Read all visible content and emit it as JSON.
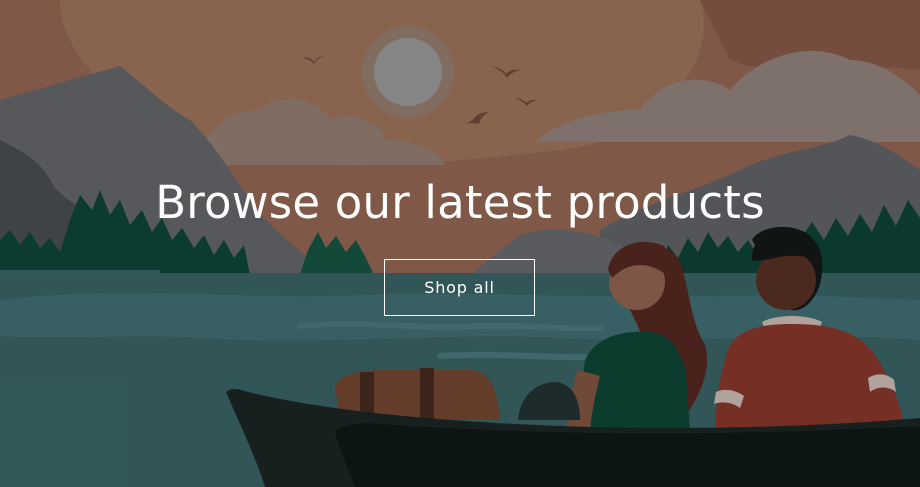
{
  "hero": {
    "title": "Browse our latest products",
    "cta_label": "Shop all",
    "illustration": "lake-canoe-sunset-illustration"
  },
  "colors": {
    "sky": "#9a6d57",
    "sun": "#a0a0a0",
    "water": "#3e6b6c",
    "mountain": "#5f6266",
    "forest": "#0f4a3a",
    "canoe": "#1b2423",
    "text": "#ffffff"
  }
}
